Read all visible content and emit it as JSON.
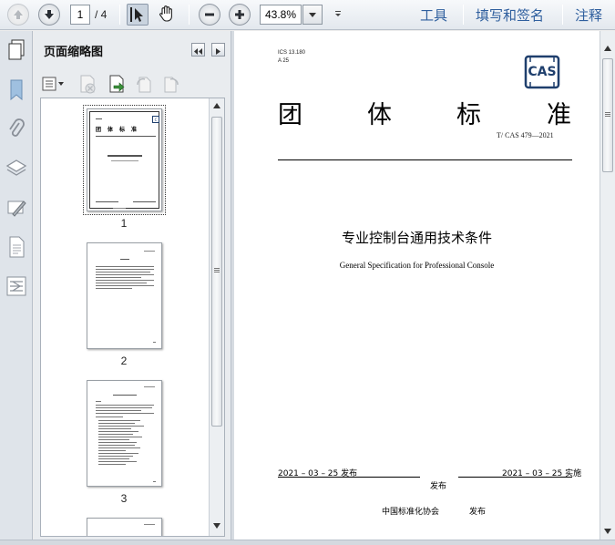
{
  "toolbar": {
    "current_page": "1",
    "page_total": "/ 4",
    "zoom": "43.8%",
    "tools_label": "工具",
    "sign_label": "填写和签名",
    "comment_label": "注释"
  },
  "thumbnails_panel": {
    "title": "页面缩略图",
    "pages": [
      "1",
      "2",
      "3"
    ]
  },
  "document": {
    "ics": "ICS  13.180",
    "ccs": "A 25",
    "standard_chars": [
      "团",
      "体",
      "标",
      "准"
    ],
    "logo_text": "CAS",
    "standard_number": "T/ CAS 479—2021",
    "title_cn": "专业控制台通用技术条件",
    "title_en": "General Specification for Professional Console",
    "publish_date": "2021 – 03 – 25 发布",
    "implement_date": "2021 – 03 – 25 实施",
    "publish_word": "发布",
    "publisher": "中国标准化协会",
    "publisher_suffix": "发布"
  },
  "colors": {
    "link": "#2f5f9e",
    "logo": "#1f3f6d"
  }
}
